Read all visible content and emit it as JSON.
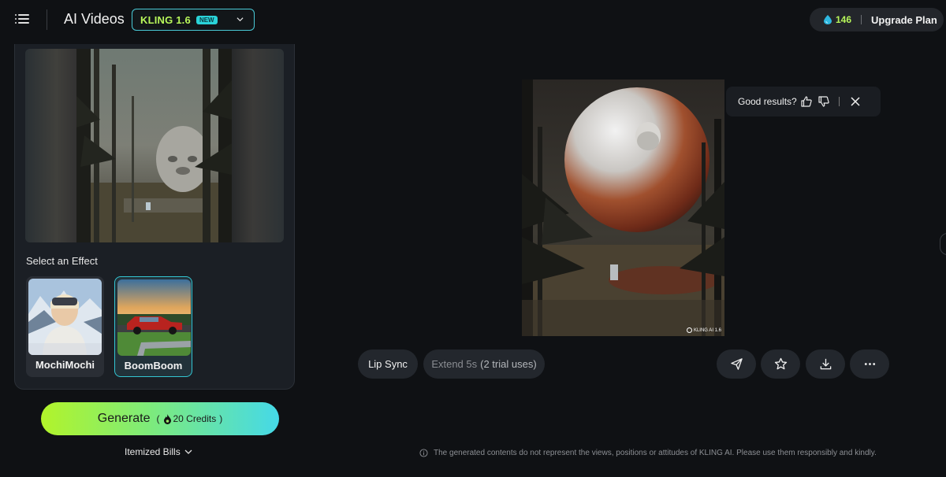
{
  "header": {
    "menu_icon": "hamburger-menu-icon",
    "title": "AI Videos",
    "model": {
      "name": "KLING 1.6",
      "badge": "NEW"
    },
    "credits": {
      "count": "146",
      "icon": "water-drop-icon"
    },
    "upgrade_label": "Upgrade Plan"
  },
  "left_panel": {
    "effect_heading": "Select an Effect",
    "effects": [
      {
        "name": "MochiMochi",
        "selected": false
      },
      {
        "name": "BoomBoom",
        "selected": true
      }
    ],
    "generate": {
      "label": "Generate",
      "credits_text": "20 Credits",
      "paren_open": "(",
      "paren_close": ")"
    },
    "bills_label": "Itemized Bills"
  },
  "result": {
    "watermark": "KLING AI 1.6",
    "feedback": {
      "prompt": "Good results?"
    },
    "actions": {
      "lip_sync": "Lip Sync",
      "extend": "Extend 5s",
      "extend_trial": "(2 trial uses)"
    },
    "icons": [
      "send-icon",
      "star-icon",
      "download-icon",
      "more-icon"
    ]
  },
  "disclaimer": "The generated contents do not represent the views, positions or attitudes of KLING AI. Please use them responsibly and kindly.",
  "colors": {
    "accent_green": "#b7f65a",
    "accent_cyan": "#33c6d3",
    "background": "#0f1114",
    "panel": "#1b1f25"
  }
}
